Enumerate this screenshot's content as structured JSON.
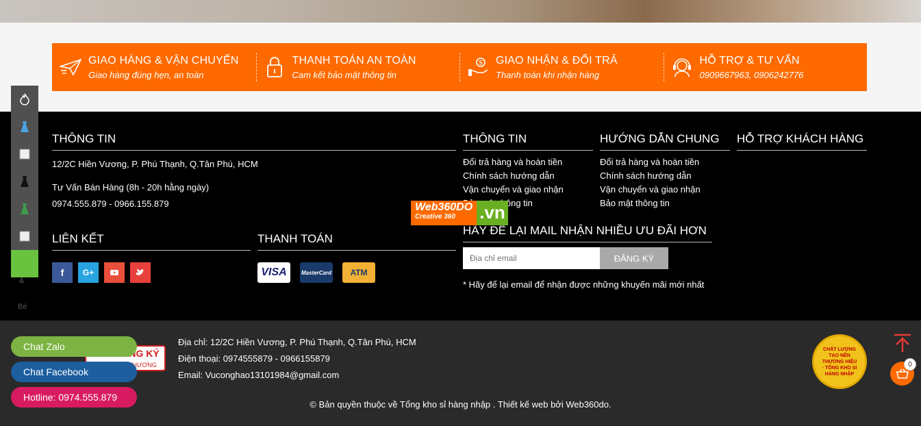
{
  "features": [
    {
      "title": "GIAO HÀNG & VẬN CHUYỂN",
      "subtitle": "Giao hàng đúng hẹn, an toàn",
      "icon": "paper-plane-icon"
    },
    {
      "title": "THANH TOÁN AN TOÀN",
      "subtitle": "Cam kết bảo mật thông tin",
      "icon": "lock-icon"
    },
    {
      "title": "GIAO NHẬN & ĐỔI TRẢ",
      "subtitle": "Thanh toán khi nhận hàng",
      "icon": "hand-money-icon"
    },
    {
      "title": "HỖ TRỢ & TƯ VẤN",
      "subtitle": "0909667963, 0906242776",
      "icon": "headset-icon"
    }
  ],
  "info": {
    "title": "THÔNG TIN",
    "address": "12/2C Hiền Vương, P. Phú Thạnh, Q.Tân Phú, HCM",
    "hours": "Tư Vấn Bán Hàng (8h - 20h hằng ngày)",
    "phones": "0974.555.879 - 0966.155.879"
  },
  "links": {
    "title": "LIÊN KẾT"
  },
  "payment": {
    "title": "THANH TOÁN",
    "methods": [
      "VISA",
      "MasterCard",
      "ATM"
    ]
  },
  "info2": {
    "title": "THÔNG TIN",
    "items": [
      "Đổi trả hàng và hoàn tiền",
      "Chính sách hướng dẫn",
      "Vận chuyển và giao nhận",
      "Bảo mật thông tin"
    ]
  },
  "guide": {
    "title": "HƯỚNG DẪN CHUNG",
    "items": [
      "Đổi trả hàng và hoàn tiền",
      "Chính sách hướng dẫn",
      "Vận chuyển và giao nhận",
      "Bảo mật thông tin"
    ]
  },
  "support": {
    "title": "HỖ TRỢ KHÁCH HÀNG"
  },
  "newsletter": {
    "title": "HÃY ĐỂ LẠI MAIL NHẬN NHIỀU ƯU ĐÃI HƠN",
    "placeholder": "Địa chỉ email",
    "button": "ĐĂNG KÝ",
    "note": "* Hãy để lại email để nhận được những khuyến mãi mới nhất"
  },
  "web360": {
    "brand": "Web360DO",
    "sub": "Creative 360",
    "tld": ".vn"
  },
  "bottom": {
    "address": "Địa chỉ: 12/2C Hiền Vương, P. Phú Thạnh, Q.Tân Phú, HCM",
    "phone": "Điện thoại: 0974555879 - 0966155879",
    "email": "Email: Vuconghao13101984@gmail.com",
    "copyright": "© Bản quyền thuộc về Tổng kho sỉ hàng nhập .  Thiết kế web bởi Web360do."
  },
  "logo_registered": {
    "line1": "ĐÃ ĐĂNG KÝ",
    "line2": "THƯƠNG"
  },
  "badge": {
    "text": "CHẤT LƯỢNG TẠO NÊN THƯƠNG HIỆU · TỔNG KHO SỈ HÀNG NHẬP"
  },
  "chat": {
    "zalo": "Chat Zalo",
    "facebook": "Chat Facebook",
    "hotline": "Hotline: 0974.555.879"
  },
  "cart": {
    "count": "0"
  },
  "side_stray": {
    "a": "&",
    "b": "Bé"
  },
  "colors": {
    "accent": "#ff6a00",
    "zalo": "#7cb342",
    "facebook": "#1d5e9f",
    "hotline": "#d81b60"
  }
}
